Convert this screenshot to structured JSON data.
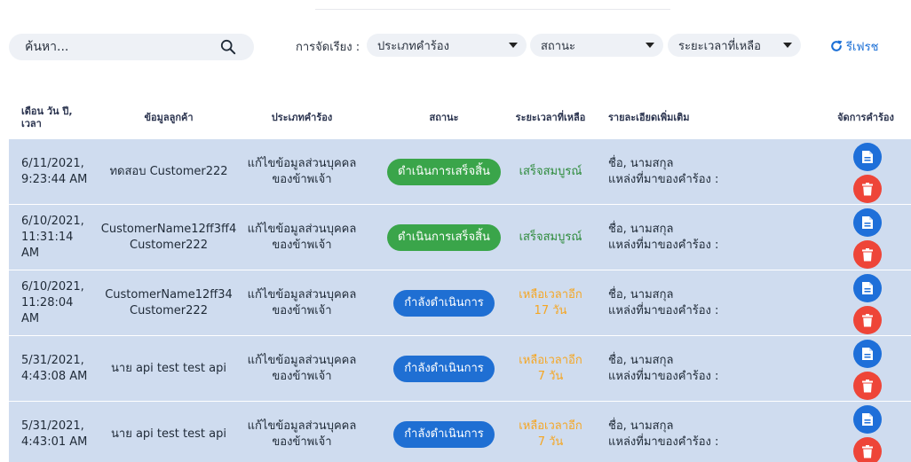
{
  "search": {
    "placeholder": "ค้นหา..."
  },
  "filters": {
    "sort_label": "การจัดเรียง :",
    "request_type": "ประเภทคำร้อง",
    "status": "สถานะ",
    "time_remaining": "ระยะเวลาที่เหลือ",
    "refresh_label": "รีเฟรช"
  },
  "table": {
    "headers": {
      "date": "เดือน วัน ปี, เวลา",
      "customer": "ข้อมูลลูกค้า",
      "type": "ประเภทคำร้อง",
      "status": "สถานะ",
      "remaining": "ระยะเวลาที่เหลือ",
      "details": "รายละเอียดเพิ่มเติม",
      "manage": "จัดการคำร้อง"
    },
    "rows": [
      {
        "date_line1": "6/11/2021,",
        "date_line2": "9:23:44 AM",
        "date_line3": "",
        "customer_line1": "ทดสอบ Customer222",
        "customer_line2": "",
        "type_line1": "แก้ไขข้อมูลส่วนบุคคล",
        "type_line2": "ของข้าพเจ้า",
        "status": "ดำเนินการเสร็จสิ้น",
        "status_kind": "done",
        "remaining_line1": "เสร็จสมบูรณ์",
        "remaining_line2": "",
        "remaining_kind": "ok",
        "detail_line1": "ชื่อ, นามสกุล",
        "detail_line2": "แหล่งที่มาของคำร้อง :"
      },
      {
        "date_line1": "6/10/2021,",
        "date_line2": "11:31:14",
        "date_line3": "AM",
        "customer_line1": "CustomerName12ff3ff4",
        "customer_line2": "Customer222",
        "type_line1": "แก้ไขข้อมูลส่วนบุคคล",
        "type_line2": "ของข้าพเจ้า",
        "status": "ดำเนินการเสร็จสิ้น",
        "status_kind": "done",
        "remaining_line1": "เสร็จสมบูรณ์",
        "remaining_line2": "",
        "remaining_kind": "ok",
        "detail_line1": "ชื่อ, นามสกุล",
        "detail_line2": "แหล่งที่มาของคำร้อง :"
      },
      {
        "date_line1": "6/10/2021,",
        "date_line2": "11:28:04",
        "date_line3": "AM",
        "customer_line1": "CustomerName12ff34",
        "customer_line2": "Customer222",
        "type_line1": "แก้ไขข้อมูลส่วนบุคคล",
        "type_line2": "ของข้าพเจ้า",
        "status": "กำลังดำเนินการ",
        "status_kind": "prog",
        "remaining_line1": "เหลือเวลาอีก",
        "remaining_line2": "17 วัน",
        "remaining_kind": "warn",
        "detail_line1": "ชื่อ, นามสกุล",
        "detail_line2": "แหล่งที่มาของคำร้อง :"
      },
      {
        "date_line1": "5/31/2021,",
        "date_line2": "4:43:08 AM",
        "date_line3": "",
        "customer_line1": "นาย api test test api",
        "customer_line2": "",
        "type_line1": "แก้ไขข้อมูลส่วนบุคคล",
        "type_line2": "ของข้าพเจ้า",
        "status": "กำลังดำเนินการ",
        "status_kind": "prog",
        "remaining_line1": "เหลือเวลาอีก",
        "remaining_line2": "7 วัน",
        "remaining_kind": "warn",
        "detail_line1": "ชื่อ, นามสกุล",
        "detail_line2": "แหล่งที่มาของคำร้อง :"
      },
      {
        "date_line1": "5/31/2021,",
        "date_line2": "4:43:01 AM",
        "date_line3": "",
        "customer_line1": "นาย api test test api",
        "customer_line2": "",
        "type_line1": "แก้ไขข้อมูลส่วนบุคคล",
        "type_line2": "ของข้าพเจ้า",
        "status": "กำลังดำเนินการ",
        "status_kind": "prog",
        "remaining_line1": "เหลือเวลาอีก",
        "remaining_line2": "7 วัน",
        "remaining_kind": "warn",
        "detail_line1": "ชื่อ, นามสกุล",
        "detail_line2": "แหล่งที่มาของคำร้อง :"
      }
    ]
  },
  "icons": {
    "search": "search-icon",
    "refresh": "refresh-icon",
    "view": "document-icon",
    "delete": "trash-icon",
    "dropdown": "caret-down-icon"
  },
  "colors": {
    "row_bg": "#cfdcef",
    "done": "#3aa54a",
    "in_progress": "#1f6fd3",
    "delete": "#ee4538",
    "warning_text": "#f5a623",
    "ok_text": "#2e8b3c",
    "link": "#1b6fd6"
  }
}
